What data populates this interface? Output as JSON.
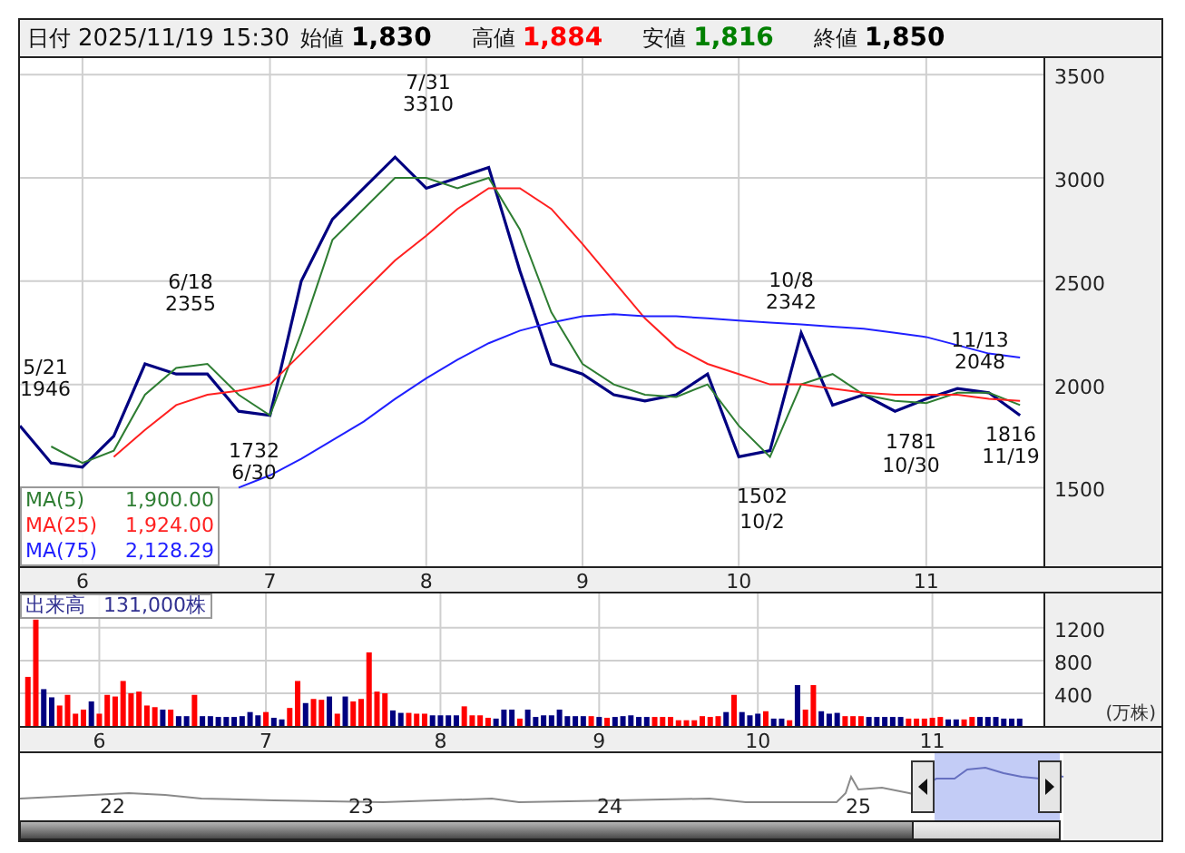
{
  "header": {
    "date_label": "日付",
    "datetime": "2025/11/19 15:30",
    "prices": [
      {
        "label": "始値",
        "value": "1,830",
        "color": "#000000"
      },
      {
        "label": "高値",
        "value": "1,884",
        "color": "#ff0000"
      },
      {
        "label": "安値",
        "value": "1,816",
        "color": "#008000"
      },
      {
        "label": "終値",
        "value": "1,850",
        "color": "#000000"
      }
    ]
  },
  "price": {
    "chart_data": {
      "type": "line",
      "categories": [
        null,
        null,
        "6",
        null,
        null,
        null,
        null,
        null,
        "7",
        null,
        null,
        null,
        null,
        "8",
        null,
        null,
        null,
        null,
        "9",
        null,
        null,
        null,
        null,
        "10",
        null,
        null,
        null,
        null,
        null,
        "11",
        null,
        null,
        null
      ],
      "series": [
        {
          "color": "#000080",
          "values": [
            1800,
            1620,
            1600,
            1750,
            2100,
            2050,
            2050,
            1870,
            1850,
            2500,
            2800,
            2950,
            3100,
            2950,
            3000,
            3050,
            2550,
            2100,
            2050,
            1950,
            1920,
            1950,
            2050,
            1650,
            1680,
            2250,
            1900,
            1950,
            1870,
            1930,
            1980,
            1960,
            1850
          ]
        },
        {
          "name": "MA(5)",
          "color": "#2e7d32",
          "values": [
            null,
            1700,
            1620,
            1680,
            1950,
            2080,
            2100,
            1950,
            1850,
            2250,
            2700,
            2850,
            3000,
            3000,
            2950,
            3000,
            2750,
            2350,
            2100,
            2000,
            1950,
            1940,
            2000,
            1800,
            1650,
            2000,
            2050,
            1950,
            1920,
            1910,
            1960,
            1960,
            1900
          ]
        },
        {
          "name": "MA(25)",
          "color": "#ff2020",
          "values": [
            null,
            null,
            null,
            1650,
            1780,
            1900,
            1950,
            1970,
            2000,
            2150,
            2300,
            2450,
            2600,
            2720,
            2850,
            2950,
            2950,
            2850,
            2680,
            2500,
            2320,
            2180,
            2100,
            2050,
            2000,
            2000,
            1980,
            1960,
            1950,
            1950,
            1950,
            1930,
            1920
          ]
        },
        {
          "name": "MA(75)",
          "color": "#2020ff",
          "values": [
            null,
            null,
            null,
            null,
            null,
            null,
            null,
            1500,
            1560,
            1640,
            1730,
            1820,
            1930,
            2030,
            2120,
            2200,
            2260,
            2300,
            2330,
            2340,
            2330,
            2330,
            2320,
            2310,
            2300,
            2290,
            2280,
            2270,
            2250,
            2230,
            2190,
            2150,
            2130
          ]
        }
      ],
      "grid": true,
      "ylim": [
        1120,
        3580
      ],
      "yticks": [
        1500,
        2000,
        2500,
        3000,
        3500
      ],
      "annotations": [
        "5/21",
        "1946",
        "6/18",
        "2355",
        "1732",
        "6/30",
        "7/31",
        "3310",
        "1502",
        "10/2",
        "10/8",
        "2342",
        "1781",
        "10/30",
        "11/13",
        "2048",
        "1816",
        "11/19"
      ]
    },
    "legend": [
      {
        "value": "1,900.00"
      },
      {
        "value": "1,924.00"
      },
      {
        "value": "2,128.29"
      }
    ]
  },
  "volume": {
    "label": "出来高",
    "value": "131,000株",
    "unit": "(万株)",
    "chart_data": {
      "type": "bar",
      "grid": true,
      "categories": [
        null,
        null,
        null,
        null,
        null,
        null,
        null,
        null,
        null,
        "6",
        null,
        null,
        null,
        null,
        null,
        null,
        null,
        null,
        null,
        null,
        null,
        null,
        null,
        null,
        null,
        null,
        null,
        null,
        null,
        null,
        "7",
        null,
        null,
        null,
        null,
        null,
        null,
        null,
        null,
        null,
        null,
        null,
        null,
        null,
        null,
        null,
        null,
        null,
        null,
        null,
        null,
        null,
        "8",
        null,
        null,
        null,
        null,
        null,
        null,
        null,
        null,
        null,
        null,
        null,
        null,
        null,
        null,
        null,
        null,
        null,
        null,
        null,
        "9",
        null,
        null,
        null,
        null,
        null,
        null,
        null,
        null,
        null,
        null,
        null,
        null,
        null,
        null,
        null,
        null,
        null,
        null,
        null,
        "10",
        null,
        null,
        null,
        null,
        null,
        null,
        null,
        null,
        null,
        null,
        null,
        null,
        null,
        null,
        null,
        null,
        null,
        null,
        null,
        null,
        null,
        "11",
        null,
        null,
        null,
        null,
        null,
        null,
        null,
        null,
        null,
        null,
        null
      ],
      "series": [
        {
          "color": "#ff0000",
          "values": [
            600,
            1300,
            null,
            null,
            250,
            380,
            150,
            200,
            null,
            150,
            380,
            360,
            550,
            400,
            420,
            250,
            230,
            null,
            200,
            null,
            null,
            380,
            null,
            null,
            null,
            null,
            null,
            null,
            null,
            null,
            170,
            null,
            null,
            220,
            550,
            null,
            330,
            320,
            null,
            150,
            null,
            300,
            330,
            900,
            420,
            400,
            null,
            null,
            160,
            150,
            150,
            null,
            null,
            null,
            null,
            240,
            130,
            130,
            100,
            null,
            null,
            null,
            90,
            null,
            null,
            null,
            null,
            null,
            null,
            null,
            null,
            120,
            null,
            100,
            null,
            null,
            null,
            null,
            null,
            110,
            110,
            110,
            70,
            70,
            70,
            120,
            110,
            120,
            null,
            380,
            null,
            null,
            null,
            180,
            null,
            null,
            70,
            null,
            200,
            500,
            null,
            null,
            null,
            120,
            120,
            120,
            null,
            null,
            null,
            null,
            null,
            90,
            90,
            90,
            100,
            110,
            null,
            null,
            80,
            110,
            null,
            null,
            null,
            null,
            null,
            null
          ]
        },
        {
          "color": "#000080",
          "values": [
            null,
            null,
            450,
            350,
            null,
            null,
            null,
            null,
            300,
            null,
            null,
            null,
            null,
            null,
            null,
            null,
            null,
            200,
            null,
            120,
            120,
            null,
            120,
            120,
            110,
            110,
            110,
            120,
            170,
            130,
            null,
            100,
            80,
            null,
            null,
            280,
            null,
            null,
            360,
            null,
            360,
            null,
            null,
            null,
            null,
            null,
            190,
            160,
            null,
            null,
            null,
            130,
            130,
            130,
            130,
            null,
            null,
            null,
            null,
            90,
            200,
            200,
            null,
            200,
            110,
            130,
            130,
            200,
            120,
            120,
            120,
            null,
            110,
            null,
            110,
            120,
            130,
            110,
            110,
            null,
            null,
            null,
            null,
            null,
            null,
            null,
            null,
            null,
            170,
            null,
            170,
            130,
            150,
            null,
            90,
            90,
            null,
            500,
            null,
            null,
            180,
            150,
            160,
            null,
            null,
            null,
            110,
            110,
            110,
            110,
            110,
            null,
            null,
            null,
            null,
            null,
            80,
            80,
            null,
            null,
            110,
            110,
            110,
            90,
            90,
            90
          ]
        }
      ],
      "ylim": [
        0,
        1620
      ],
      "yticks": [
        400,
        800,
        1200
      ]
    }
  },
  "navigator": {
    "years": [
      "22",
      "23",
      "24",
      "25"
    ]
  }
}
